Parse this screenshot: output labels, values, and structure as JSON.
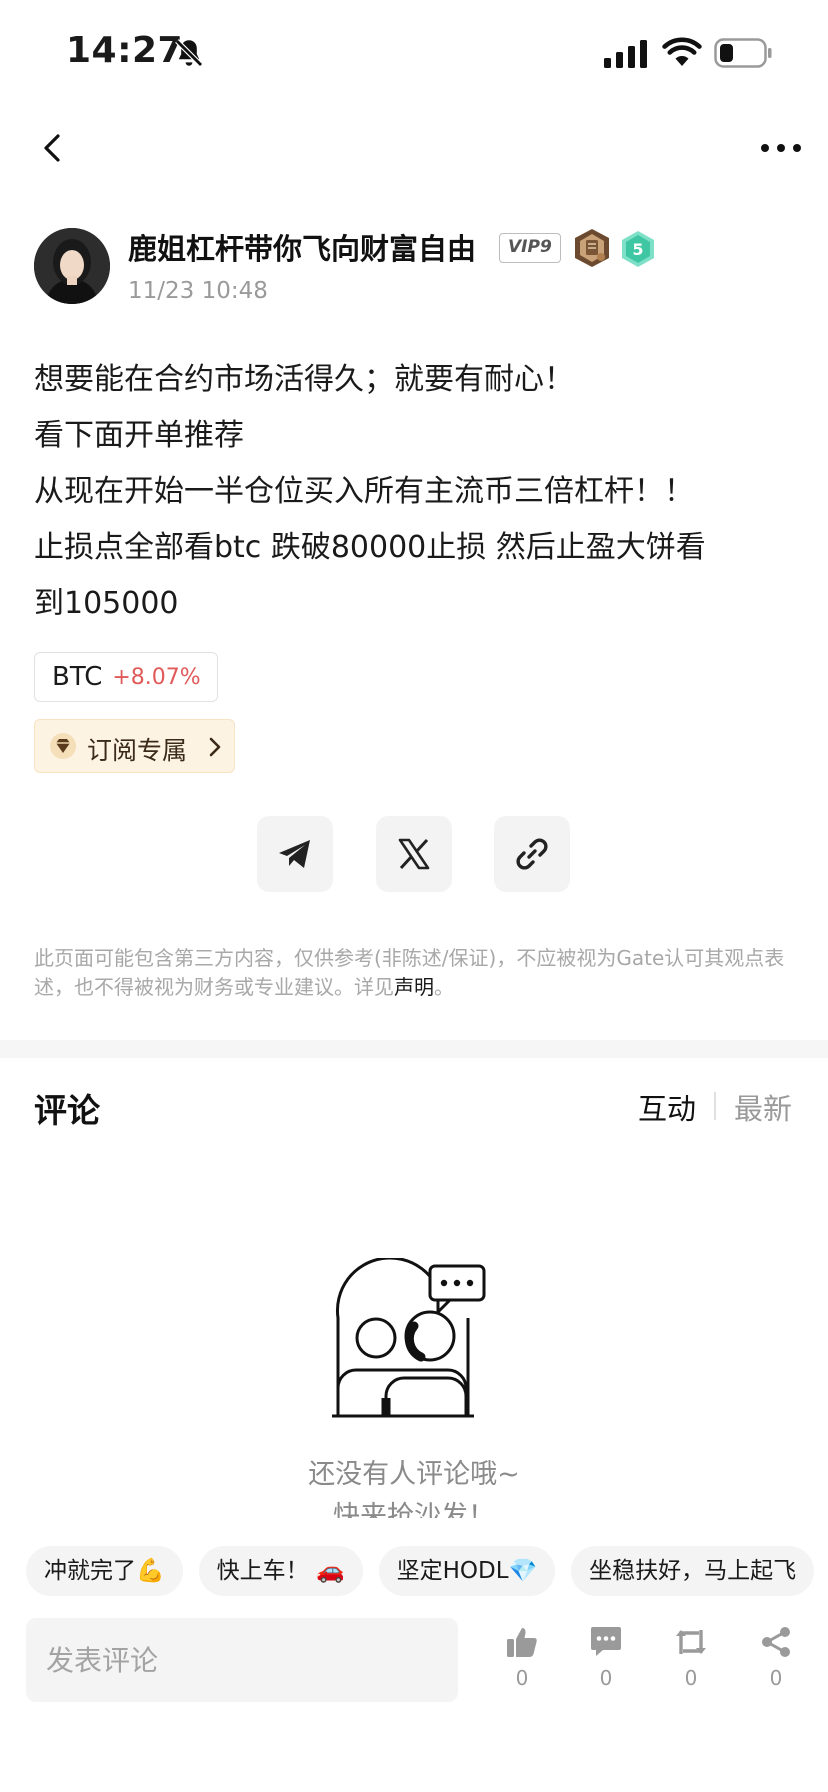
{
  "status_bar": {
    "time": "14:27"
  },
  "author": {
    "name": "鹿姐杠杆带你飞向财富自由",
    "vip": "VIP9",
    "level": "5",
    "post_time": "11/23 10:48"
  },
  "post": {
    "lines": [
      "想要能在合约市场活得久；就要有耐心！",
      "看下面开单推荐",
      "从现在开始一半仓位买入所有主流币三倍杠杆！！",
      "止损点全部看btc 跌破80000止损 然后止盈大饼看",
      "到105000"
    ]
  },
  "coin_tag": {
    "symbol": "BTC",
    "change": "+8.07%",
    "change_color": "#e15a5a"
  },
  "subscribe": {
    "label": "订阅专属"
  },
  "share": {
    "icons": [
      "telegram-icon",
      "x-icon",
      "link-icon"
    ]
  },
  "disclaimer": {
    "text": "此页面可能包含第三方内容，仅供参考(非陈述/保证)，不应被视为Gate认可其观点表述，也不得被视为财务或专业建议。详见",
    "link": "声明",
    "end": "。"
  },
  "comments": {
    "title": "评论",
    "sort_interact": "互动",
    "sort_latest": "最新",
    "empty_line1": "还没有人评论哦~",
    "empty_line2": "快来抢沙发！"
  },
  "quick_replies": [
    "冲就完了💪",
    "快上车！ 🚗",
    "坚定HODL💎",
    "坐稳扶好，马上起飞"
  ],
  "bottom_bar": {
    "input_placeholder": "发表评论",
    "like_count": "0",
    "comment_count": "0",
    "repost_count": "0",
    "share_count": "0"
  }
}
